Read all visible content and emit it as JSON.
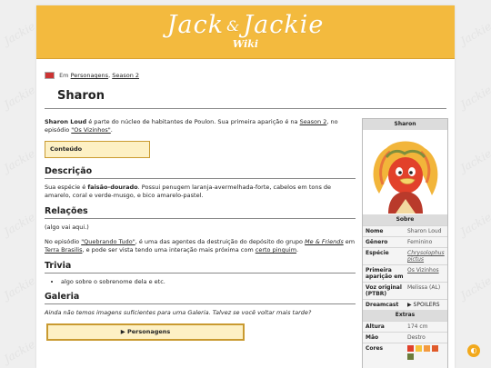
{
  "wiki": {
    "logo_main": "Jack",
    "logo_amp": "&",
    "logo_second": "Jackie",
    "logo_badge": "Wiki"
  },
  "breadcrumb": {
    "prefix": "Em",
    "cat1": "Personagens",
    "separator": ",",
    "cat2": "Season 2"
  },
  "page_title": "Sharon",
  "intro": {
    "name": "Sharon Loud",
    "text1": " é parte do núcleo de habitantes de Poulon. Sua primeira aparição é na ",
    "season_link": "Season 2",
    "text2": ", no episódio ",
    "episode_link": "\"Os Vizinhos\"",
    "text3": "."
  },
  "toc_label": "Conteúdo",
  "sections": {
    "descricao": {
      "heading": "Descrição",
      "pre": "Sua espécie é ",
      "species": "faisão-dourado",
      "post": ". Possui penugem laranja-avermelhada-forte, cabelos em tons de amarelo, coral e verde-musgo, e bico amarelo-pastel."
    },
    "relacoes": {
      "heading": "Relações",
      "p1": "(algo vai aqui.)",
      "p2a": "No episódio ",
      "p2_link1": "\"Quebrando Tudo\"",
      "p2b": ", é uma das agentes da destruição do depósito do grupo ",
      "p2_link2": "Me & Friends",
      "p2c": " em ",
      "p2_link3": "Terra Brasilis",
      "p2d": ", e pode ser vista tendo uma interação mais próxima com ",
      "p2_link4": "certo pinguim",
      "p2e": "."
    },
    "trivia": {
      "heading": "Trivia",
      "items": [
        "algo sobre o sobrenome dela e etc."
      ]
    },
    "galeria": {
      "heading": "Galeria",
      "note": "Ainda não temos imagens suficientes para uma Galeria. Talvez se você voltar mais tarde?",
      "button": "▶ Personagens"
    }
  },
  "infobox": {
    "title": "Sharon",
    "section_sobre": "Sobre",
    "rows": [
      {
        "label": "Nome",
        "value": "Sharon Loud"
      },
      {
        "label": "Gênero",
        "value": "Feminino"
      },
      {
        "label": "Espécie",
        "value": "Chrysolophus pictus"
      },
      {
        "label": "Primeira aparição em",
        "value": "Os Vizinhos"
      },
      {
        "label": "Voz original (PTBR)",
        "value": "Melissa (AL)"
      },
      {
        "label": "Dreamcast",
        "value": "▶ SPOILERS"
      }
    ],
    "section_extras": "Extras",
    "extras": [
      {
        "label": "Altura",
        "value": "174 cm"
      },
      {
        "label": "Mão",
        "value": "Destro"
      },
      {
        "label": "Cores",
        "value": ""
      }
    ],
    "colors": [
      "#e0402a",
      "#f6c33a",
      "#f39a3f",
      "#e05a2a",
      "#6b7c3b"
    ]
  },
  "background_watermark": "Jackie"
}
